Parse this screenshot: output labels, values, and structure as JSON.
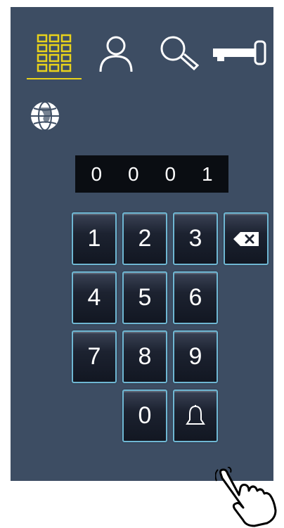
{
  "header": {
    "tabs": [
      {
        "icon": "keypad-icon",
        "active": true
      },
      {
        "icon": "user-icon",
        "active": false
      },
      {
        "icon": "search-icon",
        "active": false
      },
      {
        "icon": "key-icon",
        "active": false
      }
    ],
    "active_color": "#e8d21b"
  },
  "language": {
    "icon": "globe-icon"
  },
  "display": {
    "digits": [
      "0",
      "0",
      "0",
      "1"
    ]
  },
  "keypad": {
    "k1": "1",
    "k2": "2",
    "k3": "3",
    "k4": "4",
    "k5": "5",
    "k6": "6",
    "k7": "7",
    "k8": "8",
    "k9": "9",
    "k0": "0",
    "backspace_icon": "backspace-icon",
    "call_icon": "bell-icon"
  },
  "colors": {
    "panel": "#3d4d63",
    "key_border": "#6fb7d3",
    "display_bg": "#0a0d12"
  }
}
